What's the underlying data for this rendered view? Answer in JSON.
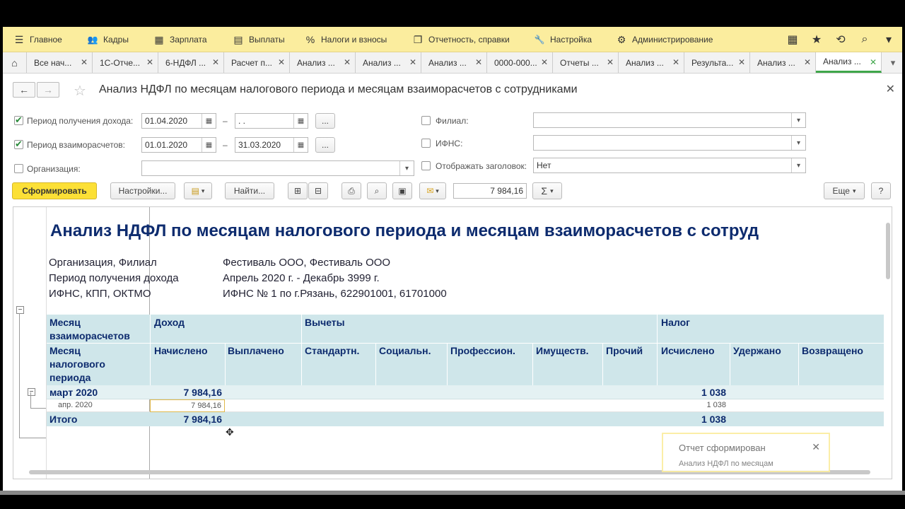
{
  "menu": {
    "items": [
      {
        "icon": "hamburger-icon",
        "glyph": "☰",
        "label": "Главное"
      },
      {
        "icon": "people-icon",
        "glyph": "👥",
        "label": "Кадры"
      },
      {
        "icon": "calculator-icon",
        "glyph": "▦",
        "label": "Зарплата"
      },
      {
        "icon": "wallet-icon",
        "glyph": "▤",
        "label": "Выплаты"
      },
      {
        "icon": "percent-icon",
        "glyph": "%",
        "label": "Налоги и взносы"
      },
      {
        "icon": "report-icon",
        "glyph": "❐",
        "label": "Отчетность, справки"
      },
      {
        "icon": "wrench-icon",
        "glyph": "🔧",
        "label": "Настройка"
      },
      {
        "icon": "gear-icon",
        "glyph": "⚙",
        "label": "Администрирование"
      }
    ]
  },
  "tabs": [
    "Все нач...",
    "1С-Отче...",
    "6-НДФЛ ...",
    "Расчет п...",
    "Анализ ...",
    "Анализ ...",
    "Анализ ...",
    "0000-000...",
    "Отчеты ...",
    "Анализ ...",
    "Результа...",
    "Анализ ...",
    "Анализ ..."
  ],
  "page": {
    "title": "Анализ НДФЛ по месяцам налогового периода и месяцам взаиморасчетов с сотрудниками"
  },
  "form": {
    "income_period_label": "Период получения дохода:",
    "income_period_from": "01.04.2020",
    "income_period_to": " .  .",
    "settlement_period_label": "Период взаиморасчетов:",
    "settlement_period_from": "01.01.2020",
    "settlement_period_to": "31.03.2020",
    "organization_label": "Организация:",
    "branch_label": "Филиал:",
    "ifns_label": "ИФНС:",
    "show_header_label": "Отображать заголовок:",
    "show_header_value": "Нет",
    "ellipsis": "..."
  },
  "toolbar": {
    "generate": "Сформировать",
    "settings": "Настройки...",
    "find": "Найти...",
    "sum_value": "7 984,16",
    "more": "Еще",
    "help": "?"
  },
  "report": {
    "title": "Анализ НДФЛ по месяцам налогового периода и месяцам взаиморасчетов с сотруд",
    "info": [
      {
        "label": "Организация, Филиал",
        "value": "Фестиваль ООО, Фестиваль ООО"
      },
      {
        "label": "Период получения дохода",
        "value": "Апрель 2020 г. - Декабрь 3999 г."
      },
      {
        "label": "ИФНС, КПП, ОКТМО",
        "value": "ИФНС № 1 по г.Рязань, 622901001, 61701000"
      }
    ],
    "head": {
      "month_settlement": [
        "Месяц",
        "взаиморасчетов"
      ],
      "month_tax": [
        "Месяц",
        "налогового",
        "периода"
      ],
      "income": "Доход",
      "deductions": "Вычеты",
      "tax": "Налог",
      "accrued": "Начислено",
      "paid": "Выплачено",
      "standard": "Стандартн.",
      "social": "Социальн.",
      "professional": "Профессион.",
      "property": "Имуществ.",
      "other": "Прочий",
      "calculated": "Исчислено",
      "withheld": "Удержано",
      "returned": "Возвращено"
    },
    "rows": [
      {
        "month": "март 2020",
        "accrued": "7 984,16",
        "calculated": "1 038"
      },
      {
        "month": "апр. 2020",
        "accrued": "7 984,16",
        "calculated": "1 038"
      },
      {
        "month": "Итого",
        "accrued": "7 984,16",
        "calculated": "1 038"
      }
    ]
  },
  "toast": {
    "title": "Отчет сформирован",
    "text": "Анализ НДФЛ по месяцам"
  }
}
